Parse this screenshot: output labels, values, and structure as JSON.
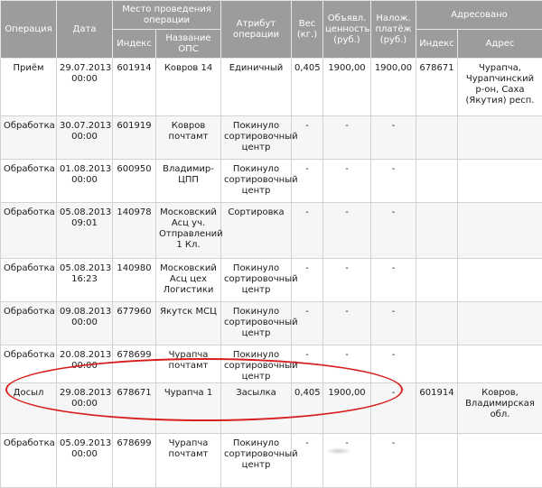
{
  "headers": {
    "operation": "Операция",
    "date": "Дата",
    "place_group": "Место проведения операции",
    "place_index": "Индекс",
    "place_name": "Название ОПС",
    "attribute": "Атрибут операции",
    "weight": "Вес (кг.)",
    "declared_value": "Объявл. ценность (руб.)",
    "cod": "Налож. платёж (руб.)",
    "addressed_group": "Адресовано",
    "addressed_index": "Индекс",
    "addressed_address": "Адрес"
  },
  "rows": [
    {
      "operation": "Приём",
      "date": "29.07.2013 00:00",
      "index": "601914",
      "name": "Ковров 14",
      "attribute": "Единичный",
      "weight": "0,405",
      "value": "1900,00",
      "cod": "1900,00",
      "addr_index": "678671",
      "address": "Чурапча, Чурапчинский р-он, Саха (Якутия) респ."
    },
    {
      "operation": "Обработка",
      "date": "30.07.2013 00:00",
      "index": "601919",
      "name": "Ковров почтамт",
      "attribute": "Покинуло сортировочный центр",
      "weight": "-",
      "value": "-",
      "cod": "-",
      "addr_index": "",
      "address": ""
    },
    {
      "operation": "Обработка",
      "date": "01.08.2013 00:00",
      "index": "600950",
      "name": "Владимир-ЦПП",
      "attribute": "Покинуло сортировочный центр",
      "weight": "-",
      "value": "-",
      "cod": "-",
      "addr_index": "",
      "address": ""
    },
    {
      "operation": "Обработка",
      "date": "05.08.2013 09:01",
      "index": "140978",
      "name": "Московский Асц уч. Отправлений 1 Кл.",
      "attribute": "Сортировка",
      "weight": "-",
      "value": "-",
      "cod": "-",
      "addr_index": "",
      "address": ""
    },
    {
      "operation": "Обработка",
      "date": "05.08.2013 16:23",
      "index": "140980",
      "name": "Московский Асц цех Логистики",
      "attribute": "Покинуло сортировочный центр",
      "weight": "-",
      "value": "-",
      "cod": "-",
      "addr_index": "",
      "address": ""
    },
    {
      "operation": "Обработка",
      "date": "09.08.2013 00:00",
      "index": "677960",
      "name": "Якутск МСЦ",
      "attribute": "Покинуло сортировочный центр",
      "weight": "-",
      "value": "-",
      "cod": "-",
      "addr_index": "",
      "address": ""
    },
    {
      "operation": "Обработка",
      "date": "20.08.2013 00:00",
      "index": "678699",
      "name": "Чурапча почтамт",
      "attribute": "Покинуло сортировочный центр",
      "weight": "-",
      "value": "-",
      "cod": "-",
      "addr_index": "",
      "address": ""
    },
    {
      "operation": "Досыл",
      "date": "29.08.2013 00:00",
      "index": "678671",
      "name": "Чурапча 1",
      "attribute": "Засылка",
      "weight": "0,405",
      "value": "1900,00",
      "cod": "-",
      "addr_index": "601914",
      "address": "Ковров, Владимирская обл."
    },
    {
      "operation": "Обработка",
      "date": "05.09.2013 00:00",
      "index": "678699",
      "name": "Чурапча почтамт",
      "attribute": "Покинуло сортировочный центр",
      "weight": "-",
      "value": "-",
      "cod": "-",
      "addr_index": "",
      "address": ""
    }
  ],
  "colors": {
    "header_bg": "#9c9c9c",
    "header_text": "#ffffff",
    "row_alt_bg": "#f6f6f6",
    "highlight_oval": "#d81f1f"
  }
}
